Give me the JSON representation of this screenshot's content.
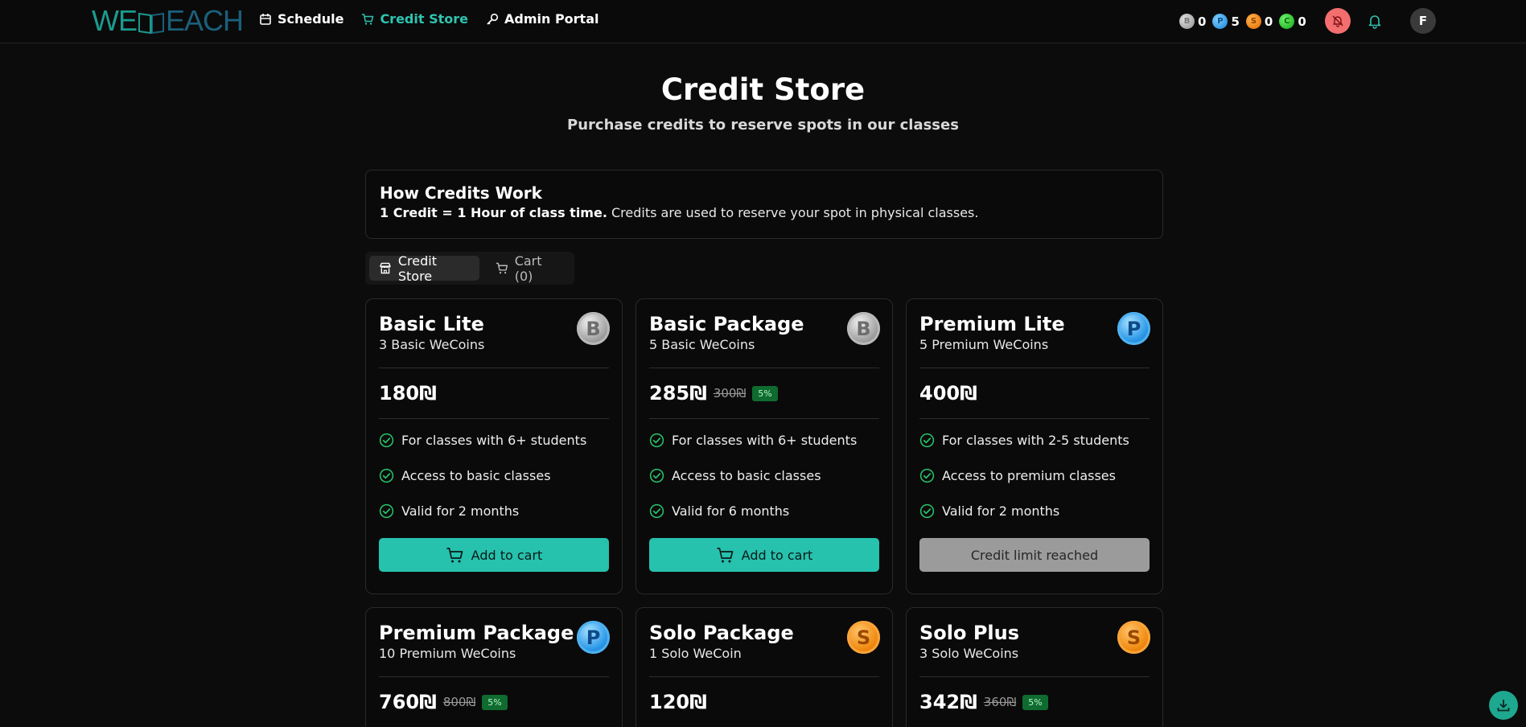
{
  "nav": {
    "logo_part1": "WE",
    "logo_part2": "EACH",
    "items": [
      {
        "label": "Schedule",
        "icon": "calendar-icon"
      },
      {
        "label": "Credit Store",
        "icon": "cart-icon",
        "active": true
      },
      {
        "label": "Admin Portal",
        "icon": "key-icon"
      }
    ]
  },
  "wallet": [
    {
      "letter": "B",
      "count": "0",
      "type": "basic"
    },
    {
      "letter": "P",
      "count": "5",
      "type": "premium"
    },
    {
      "letter": "S",
      "count": "0",
      "type": "solo"
    },
    {
      "letter": "C",
      "count": "0",
      "type": "c"
    }
  ],
  "user": {
    "avatar_initial": "F"
  },
  "header": {
    "title": "Credit Store",
    "subtitle": "Purchase credits to reserve spots in our classes"
  },
  "info": {
    "title": "How Credits Work",
    "bold": "1 Credit = 1 Hour of class time.",
    "text": " Credits are used to reserve your spot in physical classes."
  },
  "tabs": [
    {
      "label": "Credit Store",
      "active": true
    },
    {
      "label": "Cart (0)",
      "active": false
    }
  ],
  "cards": [
    {
      "name": "Basic Lite",
      "coins": "3 Basic WeCoins",
      "coin_letter": "B",
      "price": "180₪",
      "old_price": "",
      "discount": "",
      "features": [
        "For classes with 6+ students",
        "Access to basic classes",
        "Valid for 2 months"
      ],
      "button": "Add to cart",
      "button_disabled": false
    },
    {
      "name": "Basic Package",
      "coins": "5 Basic WeCoins",
      "coin_letter": "B",
      "price": "285₪",
      "old_price": "300₪",
      "discount": "5%",
      "features": [
        "For classes with 6+ students",
        "Access to basic classes",
        "Valid for 6 months"
      ],
      "button": "Add to cart",
      "button_disabled": false
    },
    {
      "name": "Premium Lite",
      "coins": "5 Premium WeCoins",
      "coin_letter": "P",
      "price": "400₪",
      "old_price": "",
      "discount": "",
      "features": [
        "For classes with 2-5 students",
        "Access to premium classes",
        "Valid for 2 months"
      ],
      "button": "Credit limit reached",
      "button_disabled": true
    },
    {
      "name": "Premium Package",
      "coins": "10 Premium WeCoins",
      "coin_letter": "P",
      "price": "760₪",
      "old_price": "800₪",
      "discount": "5%"
    },
    {
      "name": "Solo Package",
      "coins": "1 Solo WeCoin",
      "coin_letter": "S",
      "price": "120₪",
      "old_price": "",
      "discount": ""
    },
    {
      "name": "Solo Plus",
      "coins": "3 Solo WeCoins",
      "coin_letter": "S",
      "price": "342₪",
      "old_price": "360₪",
      "discount": "5%"
    }
  ],
  "colors": {
    "accent": "#26c2ad",
    "background": "#0c0c0c",
    "discount_bg": "#0f6b2f",
    "bell_off_bg": "#f36e6e"
  }
}
